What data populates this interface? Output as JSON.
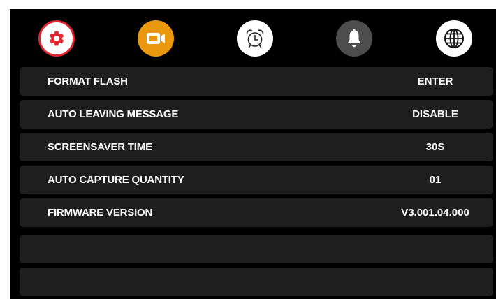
{
  "tabs": [
    {
      "icon": "gear-icon",
      "color": "#e5252e",
      "selected": true
    },
    {
      "icon": "video-camera-icon",
      "color": "#e9980e"
    },
    {
      "icon": "alarm-clock-icon",
      "color": "#ffffff"
    },
    {
      "icon": "bell-icon",
      "color": "#4d4d4d"
    },
    {
      "icon": "globe-icon",
      "color": "#ffffff"
    }
  ],
  "menu": {
    "items": [
      {
        "label": "FORMAT FLASH",
        "value": "ENTER"
      },
      {
        "label": "AUTO LEAVING MESSAGE",
        "value": "DISABLE"
      },
      {
        "label": "SCREENSAVER TIME",
        "value": "30S"
      },
      {
        "label": "AUTO CAPTURE QUANTITY",
        "value": "01"
      },
      {
        "label": "FIRMWARE VERSION",
        "value": "V3.001.04.000"
      },
      {
        "label": "",
        "value": ""
      },
      {
        "label": "",
        "value": ""
      }
    ]
  }
}
